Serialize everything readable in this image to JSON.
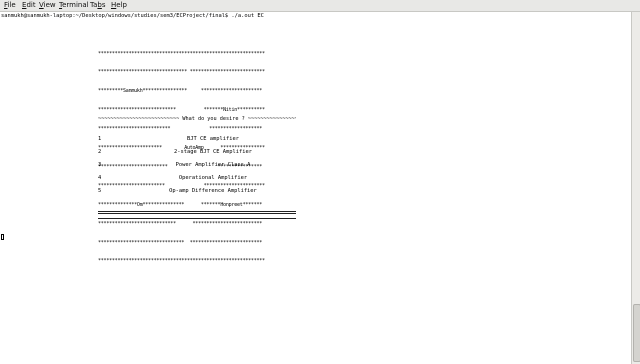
{
  "menu": [
    "File",
    "Edit",
    "View",
    "Terminal",
    "Tabs",
    "Help"
  ],
  "menu_mnemonics": [
    "F",
    "E",
    "V",
    "T",
    "b",
    "H"
  ],
  "prompt": "sanmukh@sanmukh-laptop:~/Desktop/windows/studies/sem3/ECProject/final$ ./a.out EC",
  "art_lines": [
    "************************************************************",
    "******************************** ***************************",
    "*********Sanmukh****************     **********************",
    "****************************          *******Nitin**********",
    "**************************              *******************",
    "***********************        AutoAmp      ****************",
    "*************************                  ****************",
    "************************              **********************",
    "**************Om***************      *******Honpreet*******",
    "****************************      *************************",
    "*******************************  **************************",
    "************************************************************"
  ],
  "separator": "~~~~~~~~~~~~~~~~~~~~~~~~~~ What do you desire ? ~~~~~~~~~~~~~~~~~~~~~~~~~~",
  "options": [
    {
      "num": "1",
      "label": "BJT CE amplifier"
    },
    {
      "num": "2",
      "label": "2-stage BJT CE Amplifier"
    },
    {
      "num": "3",
      "label": "Power Amplifier Class A"
    },
    {
      "num": "4",
      "label": "Operational Amplifier"
    },
    {
      "num": "5",
      "label": "Op-amp Difference Amplifier"
    }
  ]
}
